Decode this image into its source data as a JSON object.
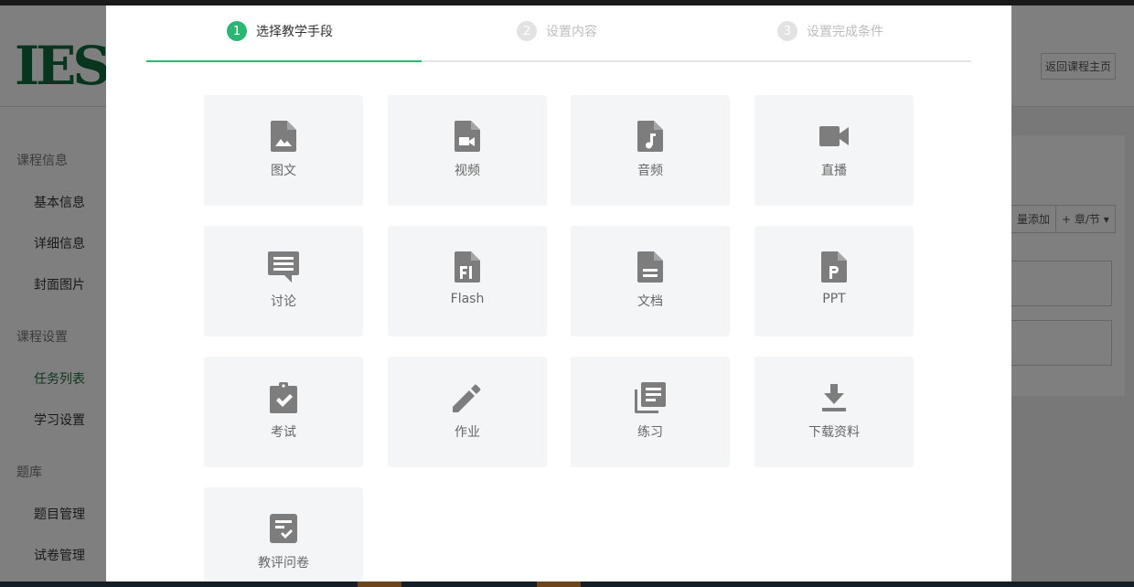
{
  "background": {
    "logo_text": "IES",
    "back_button": "返回课程主页",
    "sidebar": {
      "groups": [
        {
          "label": "课程信息",
          "items": [
            "基本信息",
            "详细信息",
            "封面图片"
          ]
        },
        {
          "label": "课程设置",
          "items": [
            "任务列表",
            "学习设置"
          ]
        },
        {
          "label": "题库",
          "items": [
            "题目管理",
            "试卷管理"
          ]
        }
      ]
    },
    "batch_add": "量添加",
    "chapter_button": "+ 章/节 ▾"
  },
  "wizard": {
    "steps": [
      {
        "number": "1",
        "label": "选择教学手段",
        "state": "active"
      },
      {
        "number": "2",
        "label": "设置内容",
        "state": "inactive"
      },
      {
        "number": "3",
        "label": "设置完成条件",
        "state": "inactive"
      }
    ],
    "accent_color": "#2bb673"
  },
  "tiles": [
    {
      "label": "图文",
      "icon": "image-file-icon"
    },
    {
      "label": "视频",
      "icon": "video-file-icon"
    },
    {
      "label": "音频",
      "icon": "audio-file-icon"
    },
    {
      "label": "直播",
      "icon": "video-camera-icon"
    },
    {
      "label": "讨论",
      "icon": "chat-bubble-icon"
    },
    {
      "label": "Flash",
      "icon": "flash-file-icon"
    },
    {
      "label": "文档",
      "icon": "document-file-icon"
    },
    {
      "label": "PPT",
      "icon": "ppt-file-icon"
    },
    {
      "label": "考试",
      "icon": "clipboard-check-icon"
    },
    {
      "label": "作业",
      "icon": "pencil-icon"
    },
    {
      "label": "练习",
      "icon": "library-books-icon"
    },
    {
      "label": "下载资料",
      "icon": "download-icon"
    },
    {
      "label": "教评问卷",
      "icon": "survey-check-icon"
    }
  ]
}
